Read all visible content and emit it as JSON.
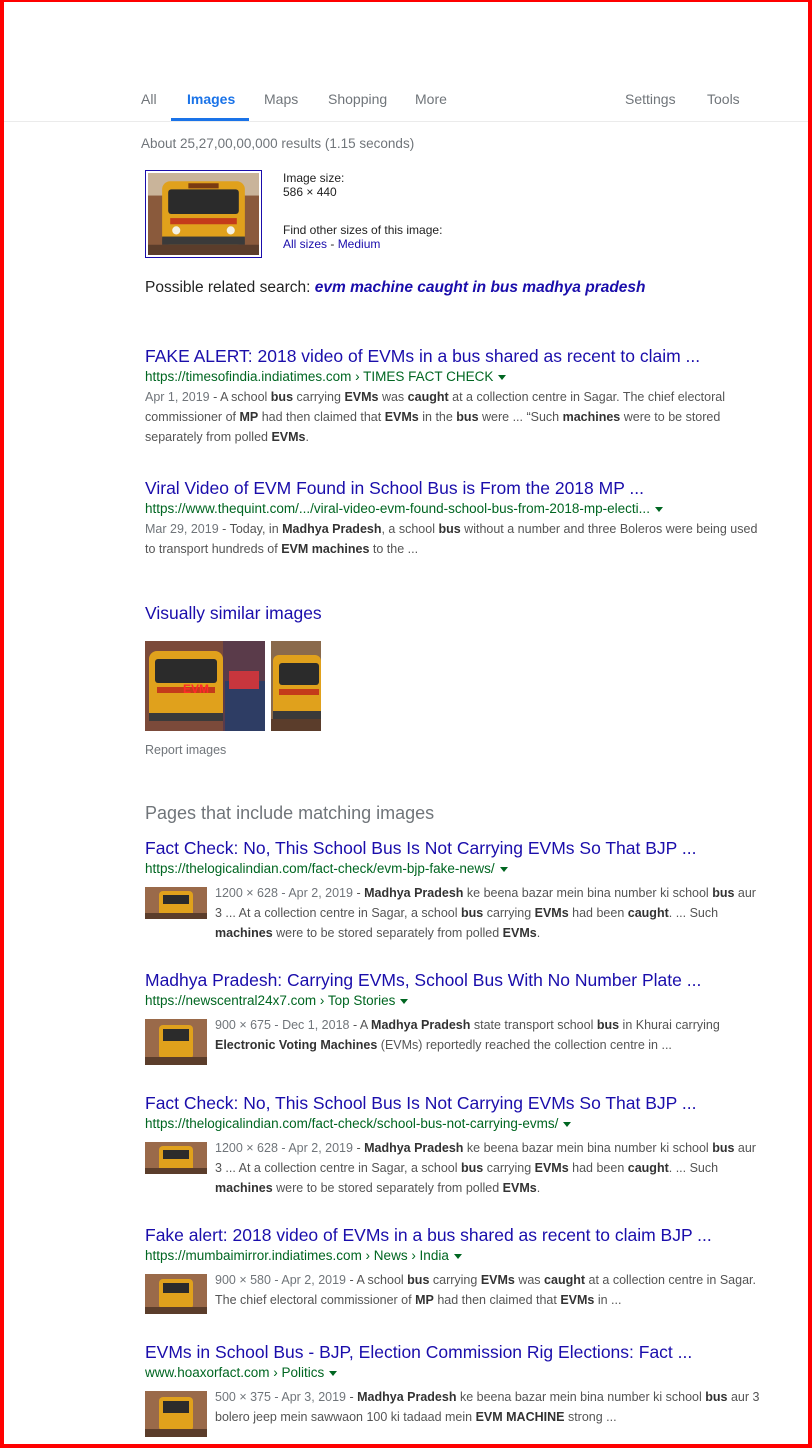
{
  "tabs": {
    "all": "All",
    "images": "Images",
    "maps": "Maps",
    "shopping": "Shopping",
    "more": "More",
    "settings": "Settings",
    "tools": "Tools"
  },
  "stats": "About 25,27,00,00,000 results (1.15 seconds)",
  "image_info": {
    "size_label": "Image size:",
    "size_value": "586 × 440",
    "find_label": "Find other sizes of this image:",
    "all_sizes": "All sizes",
    "separator": " - ",
    "medium": "Medium"
  },
  "related": {
    "label": "Possible related search: ",
    "query": "evm machine caught in bus madhya pradesh"
  },
  "results": [
    {
      "title": "FAKE ALERT: 2018 video of EVMs in a bus shared as recent to claim ...",
      "url": "https://timesofindia.indiatimes.com › TIMES FACT CHECK",
      "date": "Apr 1, 2019",
      "snippet_html": "A school <b>bus</b> carrying <b>EVMs</b> was <b>caught</b> at a collection centre in Sagar. The chief electoral commissioner of <b>MP</b> had then claimed that <b>EVMs</b> in the <b>bus</b> were ... “Such <b>machines</b> were to be stored separately from polled <b>EVMs</b>."
    },
    {
      "title": "Viral Video of EVM Found in School Bus is From the 2018 MP ...",
      "url": "https://www.thequint.com/.../viral-video-evm-found-school-bus-from-2018-mp-electi...",
      "date": "Mar 29, 2019",
      "snippet_html": "Today, in <b>Madhya Pradesh</b>, a school <b>bus</b> without a number and three Boleros were being used to transport hundreds of <b>EVM machines</b> to the ..."
    }
  ],
  "visually_similar": "Visually similar images",
  "report_images": "Report images",
  "pages_heading": "Pages that include matching images",
  "pages": [
    {
      "title": "Fact Check: No, This School Bus Is Not Carrying EVMs So That BJP ...",
      "url": "https://thelogicalindian.com/fact-check/evm-bjp-fake-news/",
      "meta": "1200 × 628 - Apr 2, 2019",
      "snippet_html": "<b>Madhya Pradesh</b> ke beena bazar mein bina number ki school <b>bus</b> aur 3 ... At a collection centre in Sagar, a school <b>bus</b> carrying <b>EVMs</b> had been <b>caught</b>. ... Such <b>machines</b> were to be stored separately from polled <b>EVMs</b>."
    },
    {
      "title": "Madhya Pradesh: Carrying EVMs, School Bus With No Number Plate ...",
      "url": "https://newscentral24x7.com › Top Stories",
      "meta": "900 × 675 - Dec 1, 2018",
      "snippet_html": "A <b>Madhya Pradesh</b> state transport school <b>bus</b> in Khurai carrying <b>Electronic Voting Machines</b> (EVMs) reportedly reached the collection centre in ..."
    },
    {
      "title": "Fact Check: No, This School Bus Is Not Carrying EVMs So That BJP ...",
      "url": "https://thelogicalindian.com/fact-check/school-bus-not-carrying-evms/",
      "meta": "1200 × 628 - Apr 2, 2019",
      "snippet_html": "<b>Madhya Pradesh</b> ke beena bazar mein bina number ki school <b>bus</b> aur 3 ... At a collection centre in Sagar, a school <b>bus</b> carrying <b>EVMs</b> had been <b>caught</b>. ... Such <b>machines</b> were to be stored separately from polled <b>EVMs</b>."
    },
    {
      "title": "Fake alert: 2018 video of EVMs in a bus shared as recent to claim BJP ...",
      "url": "https://mumbaimirror.indiatimes.com › News › India",
      "meta": "900 × 580 - Apr 2, 2019",
      "snippet_html": "A school <b>bus</b> carrying <b>EVMs</b> was <b>caught</b> at a collection centre in Sagar. The chief electoral commissioner of <b>MP</b> had then claimed that <b>EVMs</b> in ..."
    },
    {
      "title": "EVMs in School Bus - BJP, Election Commission Rig Elections: Fact ...",
      "url": "www.hoaxorfact.com › Politics",
      "meta": "500 × 375 - Apr 3, 2019",
      "snippet_html": "<b>Madhya Pradesh</b> ke beena bazar mein bina number ki school <b>bus</b> aur 3 bolero jeep mein sawwaon 100 ki tadaad mein <b>EVM MACHINE</b> strong ..."
    }
  ],
  "colors": {
    "link": "#1a0dab",
    "url": "#006621",
    "active_tab": "#1a73e8",
    "frame": "#ff0000"
  }
}
